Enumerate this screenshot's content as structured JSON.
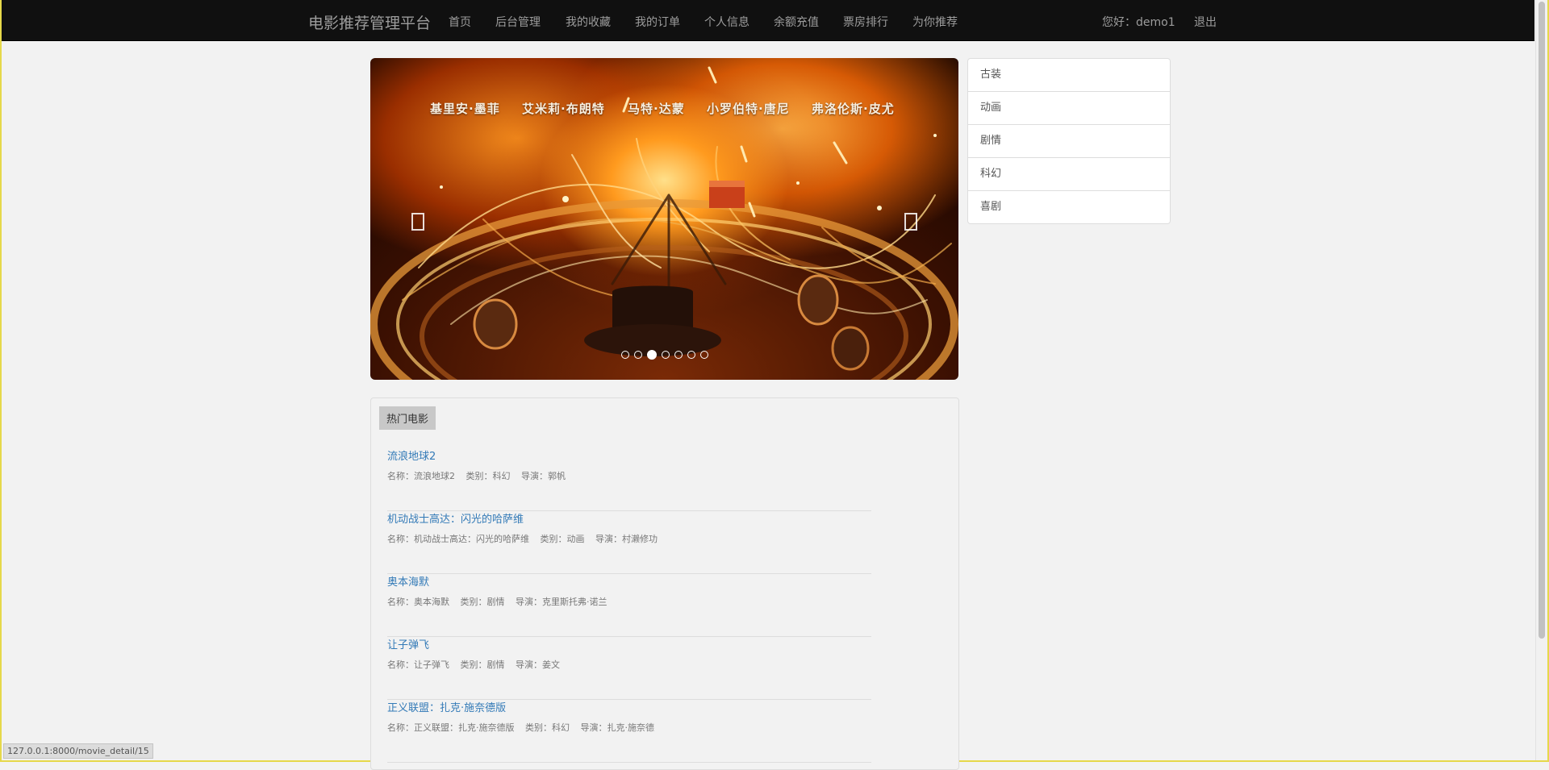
{
  "nav": {
    "brand": "电影推荐管理平台",
    "items": [
      "首页",
      "后台管理",
      "我的收藏",
      "我的订单",
      "个人信息",
      "余额充值",
      "票房排行",
      "为你推荐"
    ],
    "greeting": "您好：demo1",
    "logout": "退出"
  },
  "carousel": {
    "actors": [
      "基里安·墨菲",
      "艾米莉·布朗特",
      "马特·达蒙",
      "小罗伯特·唐尼",
      "弗洛伦斯·皮尤"
    ],
    "prev_icon": "chevron-left-icon",
    "next_icon": "chevron-right-icon",
    "slide_count": 7,
    "active_index": 2
  },
  "categories": [
    "古装",
    "动画",
    "剧情",
    "科幻",
    "喜剧"
  ],
  "hot_movies": {
    "title": "热门电影",
    "items": [
      {
        "title": "流浪地球2",
        "name": "名称：流浪地球2",
        "category": "类别：科幻",
        "director": "导演：郭帆"
      },
      {
        "title": "机动战士高达：闪光的哈萨维",
        "name": "名称：机动战士高达：闪光的哈萨维",
        "category": "类别：动画",
        "director": "导演：村濑修功"
      },
      {
        "title": "奥本海默",
        "name": "名称：奥本海默",
        "category": "类别：剧情",
        "director": "导演：克里斯托弗·诺兰"
      },
      {
        "title": "让子弹飞",
        "name": "名称：让子弹飞",
        "category": "类别：剧情",
        "director": "导演：姜文"
      },
      {
        "title": "正义联盟：扎克·施奈德版",
        "name": "名称：正义联盟：扎克·施奈德版",
        "category": "类别：科幻",
        "director": "导演：扎克·施奈德"
      }
    ]
  },
  "status_url": "127.0.0.1:8000/movie_detail/15"
}
